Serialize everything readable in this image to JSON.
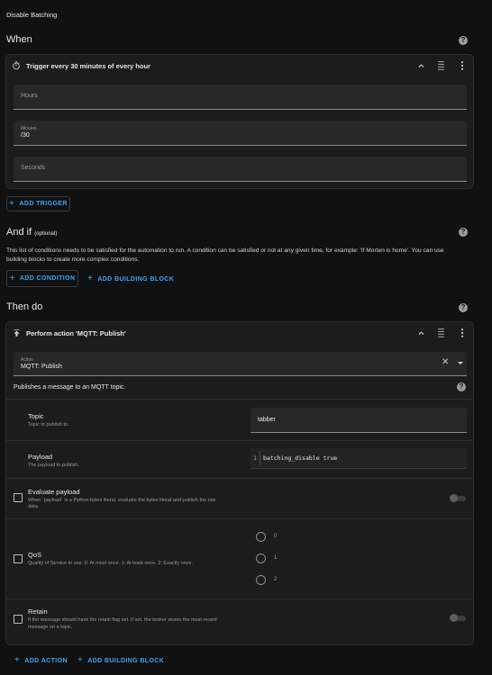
{
  "page": {
    "title": "Disable Batching"
  },
  "when": {
    "heading": "When",
    "trigger": {
      "title": "Trigger every 30 minutes of every hour",
      "hours_label": "Hours",
      "minutes_label": "Minutes",
      "minutes_value": "/30",
      "seconds_label": "Seconds"
    },
    "add_trigger_label": "ADD TRIGGER"
  },
  "and_if": {
    "heading": "And if",
    "optional": "(optional)",
    "description_line1": "This list of conditions needs to be satisfied for the automation to run. A condition can be satisfied or not at any given time, for example: 'If Morten is home'. You can use",
    "description_line2": "building blocks to create more complex conditions.",
    "add_condition_label": "ADD CONDITION",
    "add_building_block_label": "ADD BUILDING BLOCK"
  },
  "then_do": {
    "heading": "Then do",
    "action": {
      "title": "Perform action 'MQTT: Publish'",
      "action_field_label": "Action",
      "action_field_value": "MQTT: Publish",
      "description": "Publishes a message to an MQTT topic.",
      "topic": {
        "label": "Topic",
        "description": "Topic to publish to.",
        "value": "tabber"
      },
      "payload": {
        "label": "Payload",
        "description": "The payload to publish.",
        "line_number": "1",
        "code": "batching_disable true"
      },
      "evaluate_payload": {
        "label": "Evaluate payload",
        "description_line1": "When `payload` is a Python bytes literal, evaluate the bytes literal and publish the raw",
        "description_line2": "data."
      },
      "qos": {
        "label": "QoS",
        "description": "Quality of Service to use. 0: At most once. 1: At least once. 2: Exactly once.",
        "options": [
          "0",
          "1",
          "2"
        ]
      },
      "retain": {
        "label": "Retain",
        "description_line1": "If the message should have the retain flag set. If set, the broker stores the most recent",
        "description_line2": "message on a topic."
      }
    },
    "add_action_label": "ADD ACTION",
    "add_building_block_label": "ADD BUILDING BLOCK"
  },
  "colors": {
    "accent": "#3ea6f5",
    "background": "#111111",
    "card": "#1c1c1c",
    "field": "#282828"
  },
  "icons": [
    "timer-icon",
    "chevron-up-icon",
    "drag-handle-icon",
    "more-vert-icon",
    "help-icon",
    "mqtt-publish-icon",
    "clear-icon",
    "dropdown-arrow-icon",
    "plus-icon"
  ]
}
